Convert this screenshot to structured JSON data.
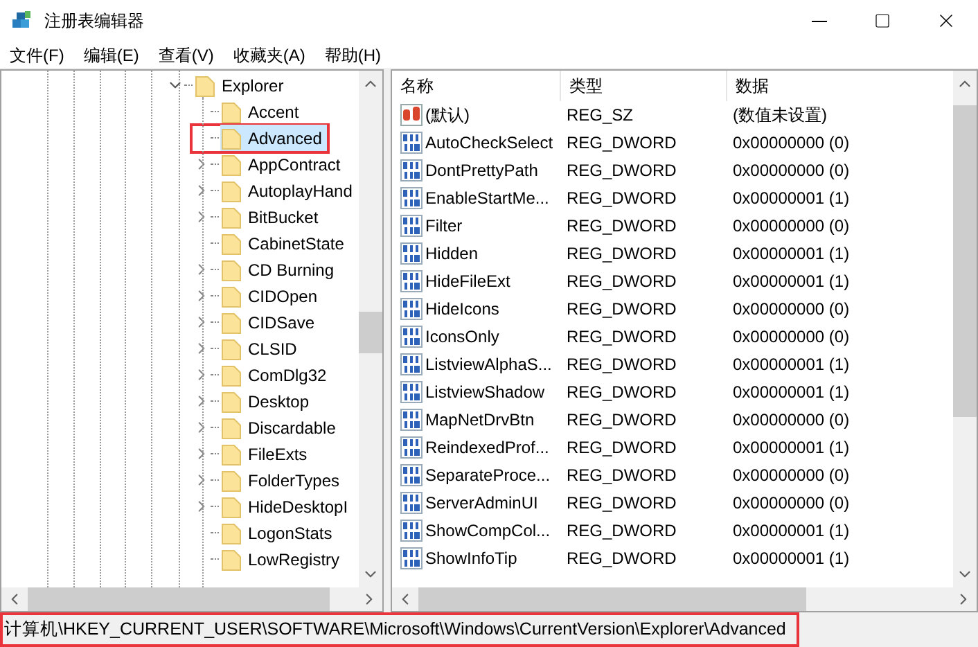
{
  "window": {
    "title": "注册表编辑器"
  },
  "menu": [
    "文件(F)",
    "编辑(E)",
    "查看(V)",
    "收藏夹(A)",
    "帮助(H)"
  ],
  "tree": [
    {
      "label": "Explorer",
      "kind": "expanded",
      "selected": false,
      "highlighted": false,
      "children": [
        {
          "label": "Accent",
          "kind": "leaf",
          "selected": false,
          "highlighted": false
        },
        {
          "label": "Advanced",
          "kind": "leaf",
          "selected": true,
          "highlighted": true
        },
        {
          "label": "AppContract",
          "kind": "collapsed",
          "selected": false,
          "highlighted": false
        },
        {
          "label": "AutoplayHand",
          "kind": "collapsed",
          "selected": false,
          "highlighted": false
        },
        {
          "label": "BitBucket",
          "kind": "collapsed",
          "selected": false,
          "highlighted": false
        },
        {
          "label": "CabinetState",
          "kind": "leaf",
          "selected": false,
          "highlighted": false
        },
        {
          "label": "CD Burning",
          "kind": "collapsed",
          "selected": false,
          "highlighted": false
        },
        {
          "label": "CIDOpen",
          "kind": "collapsed",
          "selected": false,
          "highlighted": false
        },
        {
          "label": "CIDSave",
          "kind": "collapsed",
          "selected": false,
          "highlighted": false
        },
        {
          "label": "CLSID",
          "kind": "collapsed",
          "selected": false,
          "highlighted": false
        },
        {
          "label": "ComDlg32",
          "kind": "collapsed",
          "selected": false,
          "highlighted": false
        },
        {
          "label": "Desktop",
          "kind": "collapsed",
          "selected": false,
          "highlighted": false
        },
        {
          "label": "Discardable",
          "kind": "collapsed",
          "selected": false,
          "highlighted": false
        },
        {
          "label": "FileExts",
          "kind": "collapsed",
          "selected": false,
          "highlighted": false
        },
        {
          "label": "FolderTypes",
          "kind": "collapsed",
          "selected": false,
          "highlighted": false
        },
        {
          "label": "HideDesktopI",
          "kind": "collapsed",
          "selected": false,
          "highlighted": false
        },
        {
          "label": "LogonStats",
          "kind": "leaf",
          "selected": false,
          "highlighted": false
        },
        {
          "label": "LowRegistry",
          "kind": "leaf",
          "selected": false,
          "highlighted": false
        }
      ]
    }
  ],
  "table": {
    "columns": [
      "名称",
      "类型",
      "数据"
    ],
    "rows": [
      {
        "kind": "string",
        "name": "(默认)",
        "type": "REG_SZ",
        "data": "(数值未设置)"
      },
      {
        "kind": "dword",
        "name": "AutoCheckSelect",
        "type": "REG_DWORD",
        "data": "0x00000000 (0)"
      },
      {
        "kind": "dword",
        "name": "DontPrettyPath",
        "type": "REG_DWORD",
        "data": "0x00000000 (0)"
      },
      {
        "kind": "dword",
        "name": "EnableStartMe...",
        "type": "REG_DWORD",
        "data": "0x00000001 (1)"
      },
      {
        "kind": "dword",
        "name": "Filter",
        "type": "REG_DWORD",
        "data": "0x00000000 (0)"
      },
      {
        "kind": "dword",
        "name": "Hidden",
        "type": "REG_DWORD",
        "data": "0x00000001 (1)"
      },
      {
        "kind": "dword",
        "name": "HideFileExt",
        "type": "REG_DWORD",
        "data": "0x00000001 (1)"
      },
      {
        "kind": "dword",
        "name": "HideIcons",
        "type": "REG_DWORD",
        "data": "0x00000000 (0)"
      },
      {
        "kind": "dword",
        "name": "IconsOnly",
        "type": "REG_DWORD",
        "data": "0x00000000 (0)"
      },
      {
        "kind": "dword",
        "name": "ListviewAlphaS...",
        "type": "REG_DWORD",
        "data": "0x00000001 (1)"
      },
      {
        "kind": "dword",
        "name": "ListviewShadow",
        "type": "REG_DWORD",
        "data": "0x00000001 (1)"
      },
      {
        "kind": "dword",
        "name": "MapNetDrvBtn",
        "type": "REG_DWORD",
        "data": "0x00000000 (0)"
      },
      {
        "kind": "dword",
        "name": "ReindexedProf...",
        "type": "REG_DWORD",
        "data": "0x00000001 (1)"
      },
      {
        "kind": "dword",
        "name": "SeparateProce...",
        "type": "REG_DWORD",
        "data": "0x00000000 (0)"
      },
      {
        "kind": "dword",
        "name": "ServerAdminUI",
        "type": "REG_DWORD",
        "data": "0x00000000 (0)"
      },
      {
        "kind": "dword",
        "name": "ShowCompCol...",
        "type": "REG_DWORD",
        "data": "0x00000001 (1)"
      },
      {
        "kind": "dword",
        "name": "ShowInfoTip",
        "type": "REG_DWORD",
        "data": "0x00000001 (1)"
      }
    ]
  },
  "status_bar": {
    "path": "计算机\\HKEY_CURRENT_USER\\SOFTWARE\\Microsoft\\Windows\\CurrentVersion\\Explorer\\Advanced",
    "highlighted": true
  }
}
